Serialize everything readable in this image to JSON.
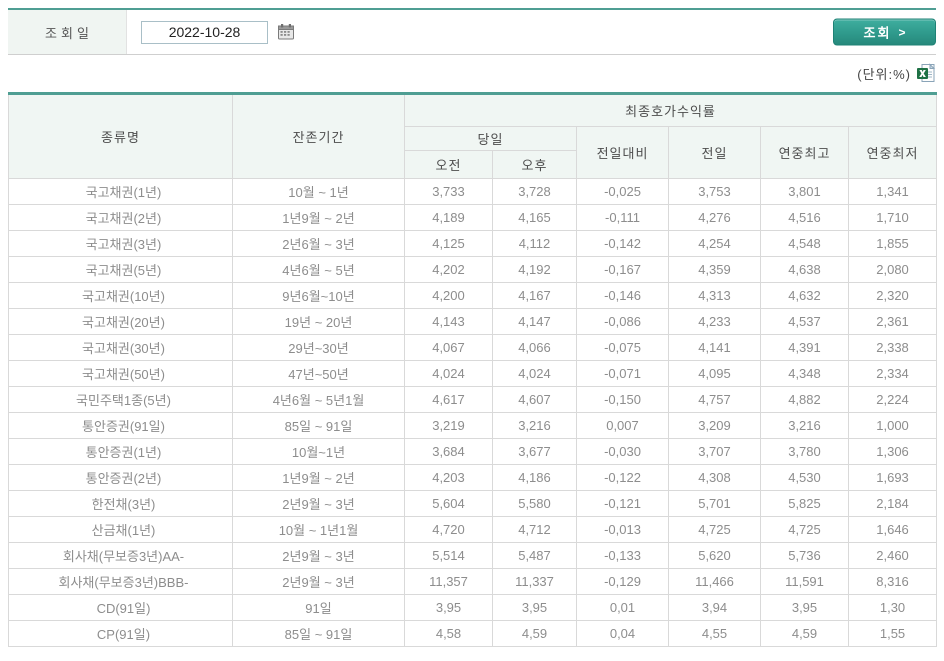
{
  "filter": {
    "date_label": "조회일",
    "date_value": "2022-10-28",
    "search_button": "조회",
    "search_arrow": ">"
  },
  "unit_note": "(단위:%)",
  "icons": {
    "calendar": "calendar-icon",
    "excel": "excel-download-icon"
  },
  "colors": {
    "accent_teal": "#359c8e",
    "header_bg": "#f0f6f3",
    "name_purple": "#5b2d66",
    "value_navy": "#23338e",
    "value_red": "#c0302c",
    "value_gray": "#8d8d8d"
  },
  "table": {
    "headers": {
      "name": "종류명",
      "period": "잔존기간",
      "yield_group": "최종호가수익률",
      "today": "당일",
      "am": "오전",
      "pm": "오후",
      "change": "전일대비",
      "prev": "전일",
      "year_high": "연중최고",
      "year_low": "연중최저"
    },
    "rows": [
      {
        "name": "국고채권(1년)",
        "period": "10월 ~ 1년",
        "am": "3,733",
        "pm": "3,728",
        "change": "-0,025",
        "prev": "3,753",
        "high": "3,801",
        "low": "1,341",
        "up": false
      },
      {
        "name": "국고채권(2년)",
        "period": "1년9월 ~ 2년",
        "am": "4,189",
        "pm": "4,165",
        "change": "-0,111",
        "prev": "4,276",
        "high": "4,516",
        "low": "1,710",
        "up": false
      },
      {
        "name": "국고채권(3년)",
        "period": "2년6월 ~ 3년",
        "am": "4,125",
        "pm": "4,112",
        "change": "-0,142",
        "prev": "4,254",
        "high": "4,548",
        "low": "1,855",
        "up": false
      },
      {
        "name": "국고채권(5년)",
        "period": "4년6월 ~ 5년",
        "am": "4,202",
        "pm": "4,192",
        "change": "-0,167",
        "prev": "4,359",
        "high": "4,638",
        "low": "2,080",
        "up": false
      },
      {
        "name": "국고채권(10년)",
        "period": "9년6월~10년",
        "am": "4,200",
        "pm": "4,167",
        "change": "-0,146",
        "prev": "4,313",
        "high": "4,632",
        "low": "2,320",
        "up": false
      },
      {
        "name": "국고채권(20년)",
        "period": "19년 ~ 20년",
        "am": "4,143",
        "pm": "4,147",
        "change": "-0,086",
        "prev": "4,233",
        "high": "4,537",
        "low": "2,361",
        "up": false
      },
      {
        "name": "국고채권(30년)",
        "period": "29년~30년",
        "am": "4,067",
        "pm": "4,066",
        "change": "-0,075",
        "prev": "4,141",
        "high": "4,391",
        "low": "2,338",
        "up": false
      },
      {
        "name": "국고채권(50년)",
        "period": "47년~50년",
        "am": "4,024",
        "pm": "4,024",
        "change": "-0,071",
        "prev": "4,095",
        "high": "4,348",
        "low": "2,334",
        "up": false
      },
      {
        "name": "국민주택1종(5년)",
        "period": "4년6월 ~ 5년1월",
        "am": "4,617",
        "pm": "4,607",
        "change": "-0,150",
        "prev": "4,757",
        "high": "4,882",
        "low": "2,224",
        "up": false
      },
      {
        "name": "통안증권(91일)",
        "period": "85일 ~ 91일",
        "am": "3,219",
        "pm": "3,216",
        "change": "0,007",
        "prev": "3,209",
        "high": "3,216",
        "low": "1,000",
        "up": true
      },
      {
        "name": "통안증권(1년)",
        "period": "10월~1년",
        "am": "3,684",
        "pm": "3,677",
        "change": "-0,030",
        "prev": "3,707",
        "high": "3,780",
        "low": "1,306",
        "up": false
      },
      {
        "name": "통안증권(2년)",
        "period": "1년9월 ~ 2년",
        "am": "4,203",
        "pm": "4,186",
        "change": "-0,122",
        "prev": "4,308",
        "high": "4,530",
        "low": "1,693",
        "up": false
      },
      {
        "name": "한전채(3년)",
        "period": "2년9월 ~ 3년",
        "am": "5,604",
        "pm": "5,580",
        "change": "-0,121",
        "prev": "5,701",
        "high": "5,825",
        "low": "2,184",
        "up": false
      },
      {
        "name": "산금채(1년)",
        "period": "10월 ~ 1년1월",
        "am": "4,720",
        "pm": "4,712",
        "change": "-0,013",
        "prev": "4,725",
        "high": "4,725",
        "low": "1,646",
        "up": false
      },
      {
        "name": "회사채(무보증3년)AA-",
        "period": "2년9월 ~ 3년",
        "am": "5,514",
        "pm": "5,487",
        "change": "-0,133",
        "prev": "5,620",
        "high": "5,736",
        "low": "2,460",
        "up": false
      },
      {
        "name": "회사채(무보증3년)BBB-",
        "period": "2년9월 ~ 3년",
        "am": "11,357",
        "pm": "11,337",
        "change": "-0,129",
        "prev": "11,466",
        "high": "11,591",
        "low": "8,316",
        "up": false
      },
      {
        "name": "CD(91일)",
        "period": "91일",
        "am": "3,95",
        "pm": "3,95",
        "change": "0,01",
        "prev": "3,94",
        "high": "3,95",
        "low": "1,30",
        "up": true
      },
      {
        "name": "CP(91일)",
        "period": "85일 ~ 91일",
        "am": "4,58",
        "pm": "4,59",
        "change": "0,04",
        "prev": "4,55",
        "high": "4,59",
        "low": "1,55",
        "up": true
      }
    ]
  }
}
